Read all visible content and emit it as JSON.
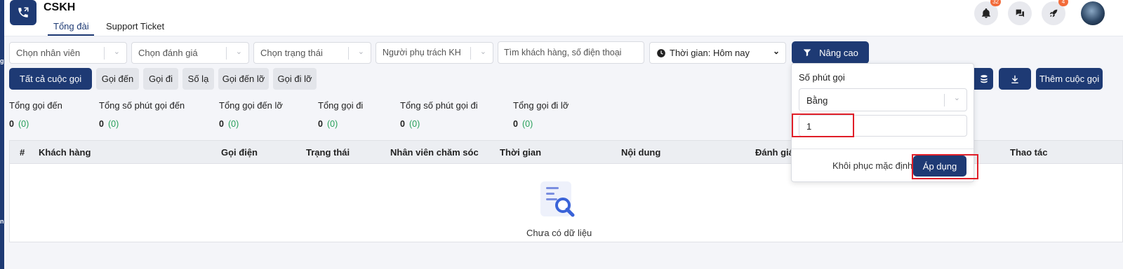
{
  "header": {
    "title": "CSKH",
    "tabs": [
      {
        "label": "Tổng đài",
        "active": true
      },
      {
        "label": "Support Ticket",
        "active": false
      }
    ],
    "notifications": {
      "icon": "bell-icon",
      "count": "32"
    },
    "chat": {
      "icon": "chat-icon"
    },
    "rocket": {
      "icon": "rocket-icon",
      "count": "4"
    },
    "avatar": {
      "icon": "avatar"
    },
    "side_letters": [
      "g",
      "n"
    ]
  },
  "filters": {
    "employee": {
      "placeholder": "Chọn nhân viên"
    },
    "rating": {
      "placeholder": "Chọn đánh giá"
    },
    "status": {
      "placeholder": "Chọn trạng thái"
    },
    "owner": {
      "placeholder": "Người phụ trách KH"
    },
    "search": {
      "placeholder": "Tìm khách hàng, số điện thoại"
    },
    "time": {
      "value": "Thời gian: Hôm nay"
    },
    "advanced_label": "Nâng cao"
  },
  "call_types": [
    "Tất cả cuộc gọi",
    "Gọi đến",
    "Gọi đi",
    "Số lạ",
    "Gọi đến lỡ",
    "Gọi đi lỡ"
  ],
  "actions": {
    "add_call_label": "Thêm cuộc gọi"
  },
  "stats": [
    {
      "label": "Tổng gọi đến",
      "value": "0",
      "sub": "(0)"
    },
    {
      "label": "Tổng số phút gọi đến",
      "value": "0",
      "sub": "(0)"
    },
    {
      "label": "Tổng gọi đến lỡ",
      "value": "0",
      "sub": "(0)"
    },
    {
      "label": "Tổng gọi đi",
      "value": "0",
      "sub": "(0)"
    },
    {
      "label": "Tổng số phút gọi đi",
      "value": "0",
      "sub": "(0)"
    },
    {
      "label": "Tổng gọi đi lỡ",
      "value": "0",
      "sub": "(0)"
    }
  ],
  "table": {
    "columns": [
      "#",
      "Khách hàng",
      "Gọi điện",
      "Trạng thái",
      "Nhân viên chăm sóc",
      "Thời gian",
      "Nội dung",
      "Đánh giá",
      "Thao tác"
    ],
    "empty_text": "Chưa có dữ liệu"
  },
  "advanced_panel": {
    "label": "Số phút gọi",
    "operator": "Bằng",
    "value": "1",
    "reset_label": "Khôi phục mặc định",
    "apply_label": "Áp dụng"
  },
  "colors": {
    "primary": "#1e3a74",
    "highlight": "#e01e28",
    "positive": "#27a05a",
    "badge": "#f26b3a"
  }
}
